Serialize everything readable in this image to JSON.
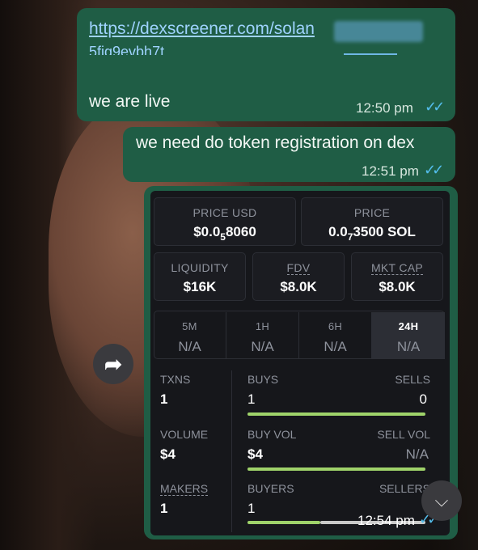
{
  "messages": {
    "m1": {
      "link_line1": "https://dexscreener.com/solan",
      "link_line2": "5fig9evbh7t",
      "text": "we are live",
      "time": "12:50 pm"
    },
    "m2": {
      "text": "we need do token registration on dex",
      "time": "12:51 pm"
    },
    "m3": {
      "time": "12:54 pm",
      "card": {
        "price_usd_label": "PRICE USD",
        "price_usd_prefix": "$0.0",
        "price_usd_sub": "5",
        "price_usd_suffix": "8060",
        "price_label": "PRICE",
        "price_prefix": "0.0",
        "price_sub": "7",
        "price_suffix": "3500 SOL",
        "liquidity_label": "LIQUIDITY",
        "liquidity_value": "$16K",
        "fdv_label": "FDV",
        "fdv_value": "$8.0K",
        "mktcap_label": "MKT CAP",
        "mktcap_value": "$8.0K",
        "timeframes": [
          {
            "label": "5M",
            "value": "N/A"
          },
          {
            "label": "1H",
            "value": "N/A"
          },
          {
            "label": "6H",
            "value": "N/A"
          },
          {
            "label": "24H",
            "value": "N/A"
          }
        ],
        "txns_label": "TXNS",
        "txns_value": "1",
        "buys_label": "BUYS",
        "buys_value": "1",
        "sells_label": "SELLS",
        "sells_value": "0",
        "volume_label": "VOLUME",
        "volume_value": "$4",
        "buyvol_label": "BUY VOL",
        "buyvol_value": "$4",
        "sellvol_label": "SELL VOL",
        "sellvol_value": "N/A",
        "makers_label": "MAKERS",
        "makers_value": "1",
        "buyers_label": "BUYERS",
        "buyers_value": "1",
        "sellers_label": "SELLERS"
      }
    }
  },
  "icons": {
    "forward": "forward-arrow-icon",
    "scroll_down": "double-chevron-down-icon",
    "read_receipt": "double-check-icon"
  },
  "colors": {
    "bubble": "#1f5d45",
    "link": "#9fd3ff",
    "ticks": "#53bdeb",
    "bar": "#9fd36a"
  }
}
